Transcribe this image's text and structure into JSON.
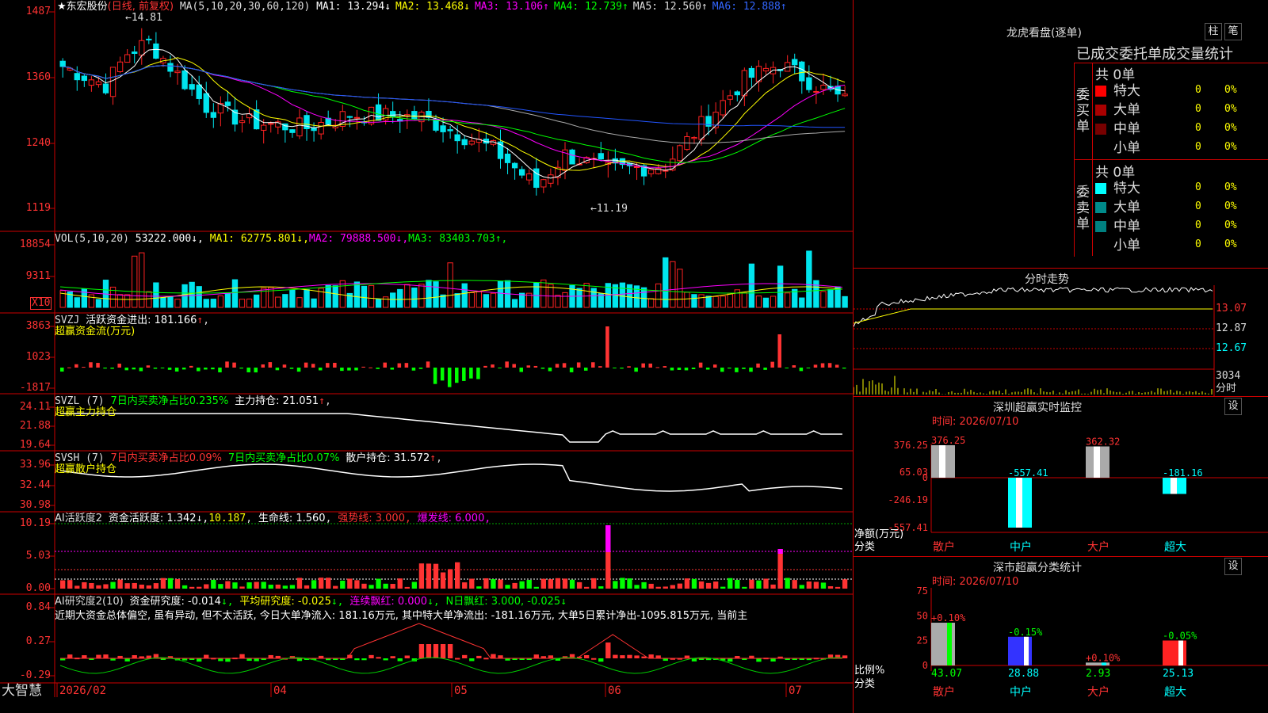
{
  "app": {
    "brand": "大智慧",
    "bottom_dates": [
      "2026/02",
      "04",
      "05",
      "06",
      "07"
    ]
  },
  "colors": {
    "up": "#ff2222",
    "down": "#00e5ee",
    "buy": "#ff3333",
    "sell": "#00ff00",
    "ma1": "#ffffff",
    "ma2": "#ffff00",
    "ma3": "#ff00ff",
    "ma4": "#00ff00",
    "ma5": "#aaaaaa",
    "ma6": "#2255ff",
    "grid": "#cc0000"
  },
  "price_panel": {
    "stock": "★东宏股份",
    "period": "(日线, 前复权)",
    "ma_prefix": "MA(5,10,20,30,60,120)",
    "ma_items": [
      {
        "label": "MA1:",
        "value": "13.294",
        "arrow": "↓",
        "color": "#ffffff"
      },
      {
        "label": "MA2:",
        "value": "13.468",
        "arrow": "↓",
        "color": "#ffff00"
      },
      {
        "label": "MA3:",
        "value": "13.106",
        "arrow": "↑",
        "color": "#ff00ff"
      },
      {
        "label": "MA4:",
        "value": "12.739",
        "arrow": "↑",
        "color": "#00ff00"
      },
      {
        "label": "MA5:",
        "value": "12.560",
        "arrow": "↑",
        "color": "#dddddd"
      },
      {
        "label": "MA6:",
        "value": "12.888",
        "arrow": "↑",
        "color": "#3366ff"
      }
    ],
    "y_ticks": [
      "1487",
      "1360",
      "1240",
      "1119"
    ],
    "high_label": "←14.81",
    "low_label": "←11.19",
    "price_high": 14.81,
    "price_low": 11.19
  },
  "volume_panel": {
    "title": "VOL(5,10,20)",
    "value": "53222.000",
    "items": [
      {
        "label": "MA1:",
        "value": "62775.801",
        "arrow": "↓",
        "color": "#ffff00"
      },
      {
        "label": "MA2:",
        "value": "79888.500",
        "arrow": "↓",
        "color": "#ff00ff"
      },
      {
        "label": "MA3:",
        "value": "83403.703",
        "arrow": "↑",
        "color": "#00ff00"
      }
    ],
    "y_ticks": [
      "18854",
      "9311"
    ],
    "unit": "X10"
  },
  "flow_panel": {
    "title": "SVZJ",
    "text": "活跃资金进出: 181.166",
    "arrow": "↑",
    "subtitle": "超赢资金流(万元)",
    "y_ticks": [
      "3863",
      "1023",
      "-1817"
    ]
  },
  "main_hold_panel": {
    "title": "SVZL (7)",
    "ratio": "7日内买卖净占比0.235%",
    "text": "主力持仓: 21.051",
    "arrow": "↑",
    "subtitle": "超赢主力持仓",
    "y_ticks": [
      "24.11",
      "21.88",
      "19.64"
    ]
  },
  "retail_panel": {
    "title": "SVSH (7)",
    "ratio1": "7日内买卖净占比0.09%",
    "ratio2": "7日内买卖净占比0.07%",
    "text": "散户持仓: 31.572",
    "arrow": "↑",
    "subtitle": "超赢散户持仓",
    "y_ticks": [
      "33.96",
      "32.44",
      "30.98"
    ]
  },
  "ai_active_panel": {
    "title": "AI活跃度2",
    "label": "资金活跃度: 1.342",
    "v2": "10.187",
    "life": "生命线: 1.560",
    "strong": "强势线: 3.000",
    "burst": "爆发线: 6.000",
    "y_ticks": [
      "10.19",
      "5.03",
      "0.00"
    ]
  },
  "ai_research_panel": {
    "title": "AI研究度2(10)",
    "label": "资金研究度: -0.014",
    "avg": "平均研究度: -0.025",
    "cont": "连续飘红: 0.000",
    "nday": "N日飘红: 3.000, -0.025",
    "comment": "近期大资金总体偏空, 虽有异动, 但不太活跃, 今日大单净流入: 181.16万元, 其中特大单净流出: -181.16万元, 大单5日累计净出-1095.815万元, 当前主",
    "y_ticks": [
      "0.84",
      "0.27",
      "-0.29"
    ]
  },
  "dragon": {
    "title": "龙虎看盘(逐单)",
    "btn_bar": "柱",
    "btn_list": "笔",
    "tabs": "已成交委托单成交量统计",
    "buy_label": "委买单",
    "sell_label": "委卖单",
    "buy_total": "共 0单",
    "sell_total": "共 0单",
    "buy_rows": [
      {
        "name": "特大",
        "count": "0",
        "pct": "0%",
        "color": "#ff0000"
      },
      {
        "name": "大单",
        "count": "0",
        "pct": "0%",
        "color": "#aa0000"
      },
      {
        "name": "中单",
        "count": "0",
        "pct": "0%",
        "color": "#770000"
      },
      {
        "name": "小单",
        "count": "0",
        "pct": "0%",
        "color": ""
      }
    ],
    "sell_rows": [
      {
        "name": "特大",
        "count": "0",
        "pct": "0%",
        "color": "#00ffff"
      },
      {
        "name": "大单",
        "count": "0",
        "pct": "0%",
        "color": "#008b8b"
      },
      {
        "name": "中单",
        "count": "0",
        "pct": "0%",
        "color": "#008080"
      },
      {
        "name": "小单",
        "count": "0",
        "pct": "0%",
        "color": ""
      }
    ]
  },
  "intraday": {
    "title": "分时走势",
    "y_ticks": [
      "13.07",
      "12.87",
      "12.67"
    ],
    "vol_tick": "3034",
    "vol_label": "分时"
  },
  "monitor": {
    "title": "深圳超赢实时监控",
    "btn": "设",
    "time": "时间: 2026/07/10",
    "y_ticks": [
      "376.25",
      "65.03",
      "0",
      "-246.19",
      "-557.41"
    ],
    "y_label_1": "净额(万元)",
    "y_label_2": "分类",
    "categories": [
      "散户",
      "中户",
      "大户",
      "超大"
    ],
    "values": [
      376.25,
      -557.41,
      362.32,
      -181.16
    ],
    "value_labels": [
      "376.25",
      "-557.41",
      "362.32",
      "-181.16"
    ]
  },
  "classify": {
    "title": "深市超赢分类统计",
    "btn": "设",
    "time": "时间: 2026/07/10",
    "y_ticks": [
      "75",
      "50",
      "25",
      "0"
    ],
    "y_label_1": "比例%",
    "y_label_2": "分类",
    "categories": [
      "散户",
      "中户",
      "大户",
      "超大"
    ],
    "values": [
      43.07,
      28.88,
      2.93,
      25.13
    ],
    "value_labels": [
      "43.07",
      "28.88",
      "2.93",
      "25.13"
    ],
    "deltas": [
      "+0.10%",
      "-0.15%",
      "+0.10%",
      "-0.05%"
    ]
  }
}
